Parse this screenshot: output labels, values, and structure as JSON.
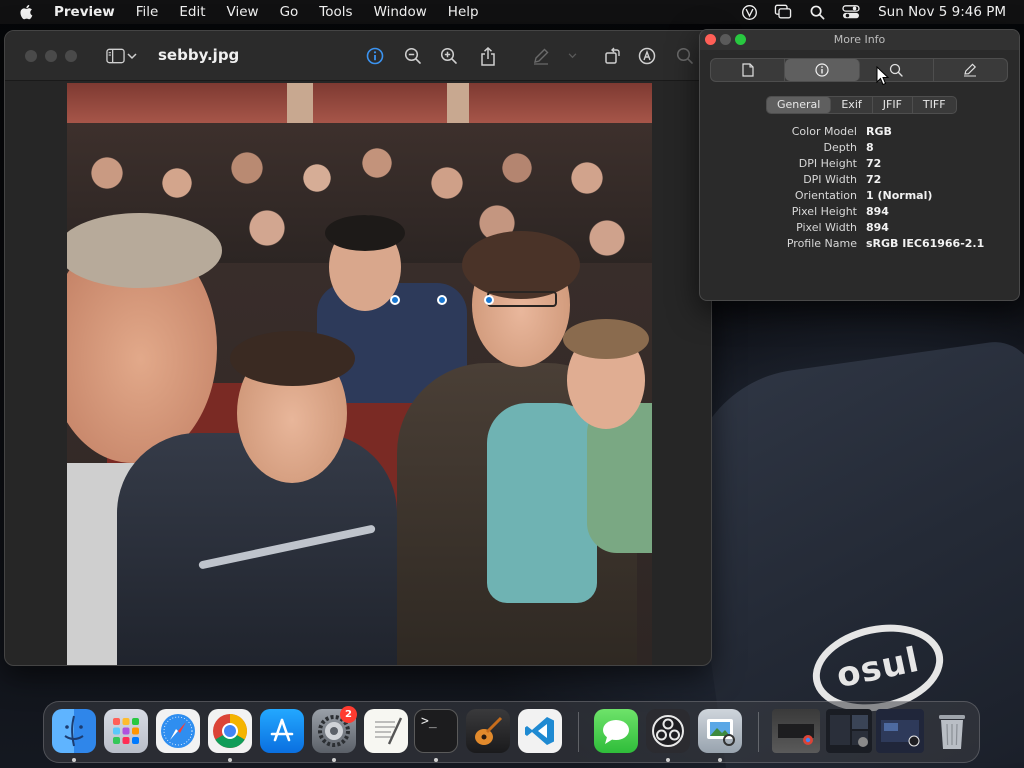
{
  "menubar": {
    "app_name": "Preview",
    "items": [
      "File",
      "Edit",
      "View",
      "Go",
      "Tools",
      "Window",
      "Help"
    ],
    "clock": "Sun Nov 5  9:46 PM",
    "status_icons": [
      "vpn-icon",
      "screen-mirroring-icon",
      "spotlight-icon",
      "control-center-icon"
    ]
  },
  "preview": {
    "title": "sebby.jpg",
    "toolbar_icons": [
      "sidebar-icon",
      "chevron-down-icon",
      "info-icon",
      "zoom-out-icon",
      "zoom-in-icon",
      "share-icon",
      "markup-pen-icon",
      "rotate-icon",
      "annotate-icon",
      "search-icon"
    ]
  },
  "info_window": {
    "title": "More Info",
    "segments": [
      "document-icon",
      "info-icon",
      "search-icon",
      "pencil-icon"
    ],
    "active_segment": 1,
    "tabs": [
      "General",
      "Exif",
      "JFIF",
      "TIFF"
    ],
    "active_tab": 0,
    "properties": [
      {
        "key": "Color Model",
        "value": "RGB"
      },
      {
        "key": "Depth",
        "value": "8"
      },
      {
        "key": "DPI Height",
        "value": "72"
      },
      {
        "key": "DPI Width",
        "value": "72"
      },
      {
        "key": "Orientation",
        "value": "1 (Normal)"
      },
      {
        "key": "Pixel Height",
        "value": "894"
      },
      {
        "key": "Pixel Width",
        "value": "894"
      },
      {
        "key": "Profile Name",
        "value": "sRGB IEC61966-2.1"
      }
    ]
  },
  "desktop": {
    "logo_text": "osul"
  },
  "dock": {
    "apps": [
      "Finder",
      "Launchpad",
      "Safari",
      "Google Chrome",
      "App Store",
      "System Settings",
      "TextEdit",
      "Terminal",
      "GarageBand",
      "Visual Studio Code",
      "Messages",
      "OBS",
      "Preview"
    ],
    "system_settings_badge": "2",
    "terminal_prompt": ">_"
  },
  "colors": {
    "accent": "#1a78d2",
    "close": "#ff5f57",
    "minimize": "#febc2e",
    "zoom": "#28c840",
    "badge": "#ff3b30"
  }
}
